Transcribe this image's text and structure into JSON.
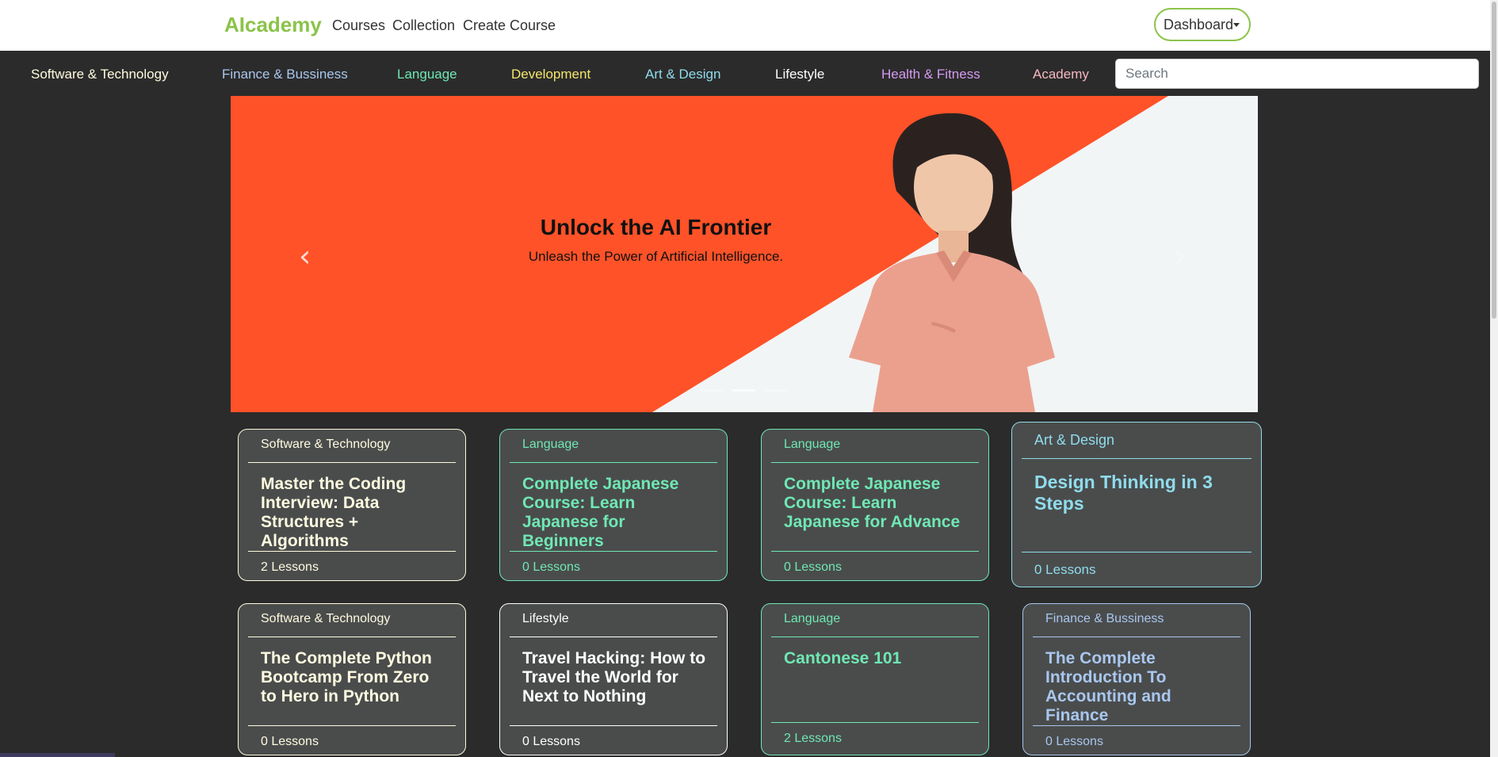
{
  "brand": "AIcademy",
  "nav": {
    "courses": "Courses",
    "collection": "Collection",
    "create_course": "Create Course",
    "dashboard": "Dashboard"
  },
  "categories": [
    {
      "label": "Software & Technology",
      "color": "#fffbe0"
    },
    {
      "label": "Finance & Bussiness",
      "color": "#a9c7ee"
    },
    {
      "label": "Language",
      "color": "#6fe8b4"
    },
    {
      "label": "Development",
      "color": "#f3e66a"
    },
    {
      "label": "Art & Design",
      "color": "#8fdcec"
    },
    {
      "label": "Lifestyle",
      "color": "#ffffff"
    },
    {
      "label": "Health & Fitness",
      "color": "#d59af3"
    },
    {
      "label": "Academy",
      "color": "#f6b8c0"
    }
  ],
  "search": {
    "placeholder": "Search"
  },
  "hero": {
    "title": "Unlock the AI Frontier",
    "subtitle": "Unleash the Power of Artificial Intelligence.",
    "slide_count": 3,
    "active_slide": 2
  },
  "courses": [
    {
      "category": "Software & Technology",
      "title": "Master the Coding Interview: Data Structures + Algorithms",
      "lessons": "2 Lessons",
      "color": "#fffbe0"
    },
    {
      "category": "Language",
      "title": "Complete Japanese Course: Learn Japanese for Beginners",
      "lessons": "0 Lessons",
      "color": "#6fe8b4"
    },
    {
      "category": "Language",
      "title": "Complete Japanese Course: Learn Japanese for Advance",
      "lessons": "0 Lessons",
      "color": "#6fe8b4"
    },
    {
      "category": "Art & Design",
      "title": "Design Thinking in 3 Steps",
      "lessons": "0 Lessons",
      "color": "#8fdcec"
    },
    {
      "category": "Software & Technology",
      "title": "The Complete Python Bootcamp From Zero to Hero in Python",
      "lessons": "0 Lessons",
      "color": "#fffbe0"
    },
    {
      "category": "Lifestyle",
      "title": "Travel Hacking: How to Travel the World for Next to Nothing",
      "lessons": "0 Lessons",
      "color": "#ffffff"
    },
    {
      "category": "Language",
      "title": "Cantonese 101",
      "lessons": "2 Lessons",
      "color": "#6fe8b4"
    },
    {
      "category": "Finance & Bussiness",
      "title": "The Complete Introduction To Accounting and Finance",
      "lessons": "0 Lessons",
      "color": "#a9c7ee"
    }
  ]
}
